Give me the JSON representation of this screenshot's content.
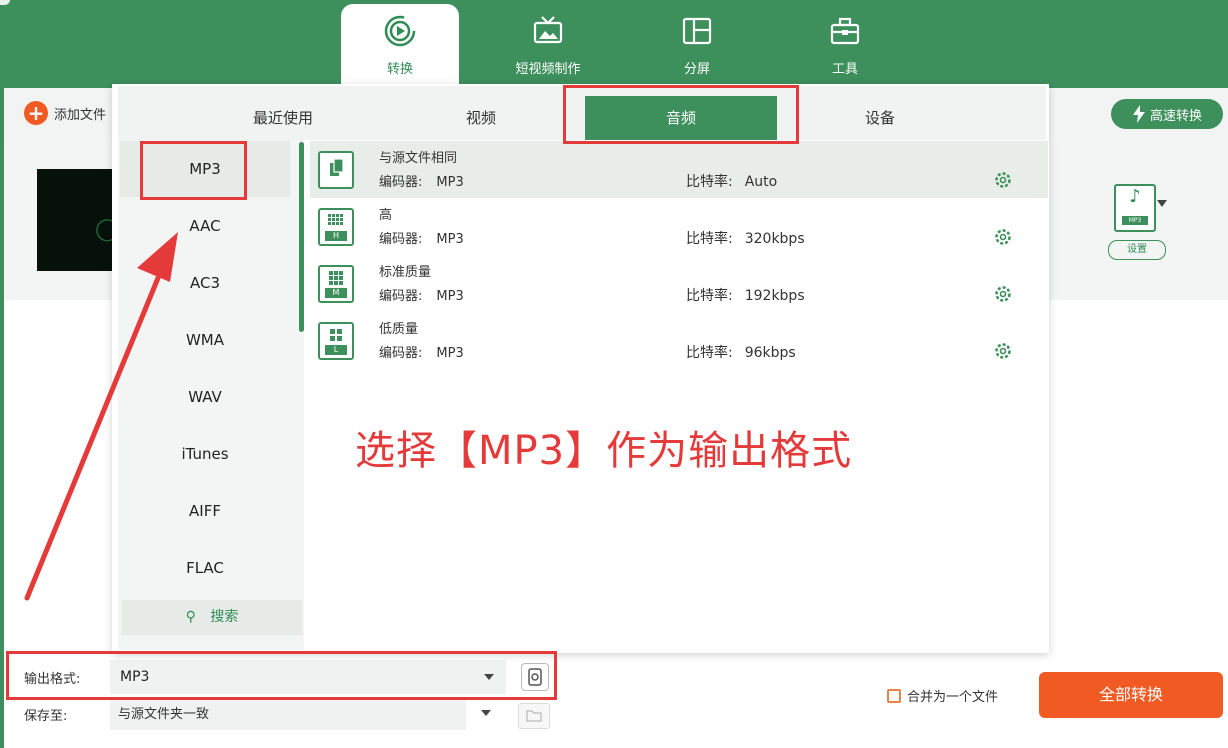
{
  "app": {
    "main_tabs": [
      {
        "label": "转换",
        "icon": "convert-icon",
        "active": true
      },
      {
        "label": "短视频制作",
        "icon": "tv-icon",
        "active": false
      },
      {
        "label": "分屏",
        "icon": "split-screen-icon",
        "active": false
      },
      {
        "label": "工具",
        "icon": "toolbox-icon",
        "active": false
      }
    ]
  },
  "toolbar": {
    "add_file_label": "添加文件",
    "speed_label": "高速转换"
  },
  "file_item": {
    "output_tag": "MP3",
    "settings_label": "设置"
  },
  "format_panel": {
    "tabs": [
      {
        "label": "最近使用"
      },
      {
        "label": "视频"
      },
      {
        "label": "音频",
        "active": true
      },
      {
        "label": "设备"
      }
    ],
    "formats": [
      "MP3",
      "AAC",
      "AC3",
      "WMA",
      "WAV",
      "iTunes",
      "AIFF",
      "FLAC"
    ],
    "selected_format": "MP3",
    "search_label": "搜索",
    "encoder_label": "编码器:",
    "bitrate_label": "比特率:",
    "qualities": [
      {
        "name": "与源文件相同",
        "encoder": "MP3",
        "bitrate": "Auto",
        "letter": ""
      },
      {
        "name": "高",
        "encoder": "MP3",
        "bitrate": "320kbps",
        "letter": "H"
      },
      {
        "name": "标准质量",
        "encoder": "MP3",
        "bitrate": "192kbps",
        "letter": "M"
      },
      {
        "name": "低质量",
        "encoder": "MP3",
        "bitrate": "96kbps",
        "letter": "L"
      }
    ]
  },
  "bottom": {
    "output_format_label": "输出格式:",
    "output_format_value": "MP3",
    "save_to_label": "保存至:",
    "save_to_value": "与源文件夹一致",
    "merge_label": "合并为一个文件",
    "convert_all_label": "全部转换"
  },
  "annotation": {
    "text": "选择【MP3】作为输出格式"
  },
  "colors": {
    "brand_green": "#3d8f5b",
    "accent_orange": "#f15a22",
    "annotation_red": "#e53a3a"
  }
}
